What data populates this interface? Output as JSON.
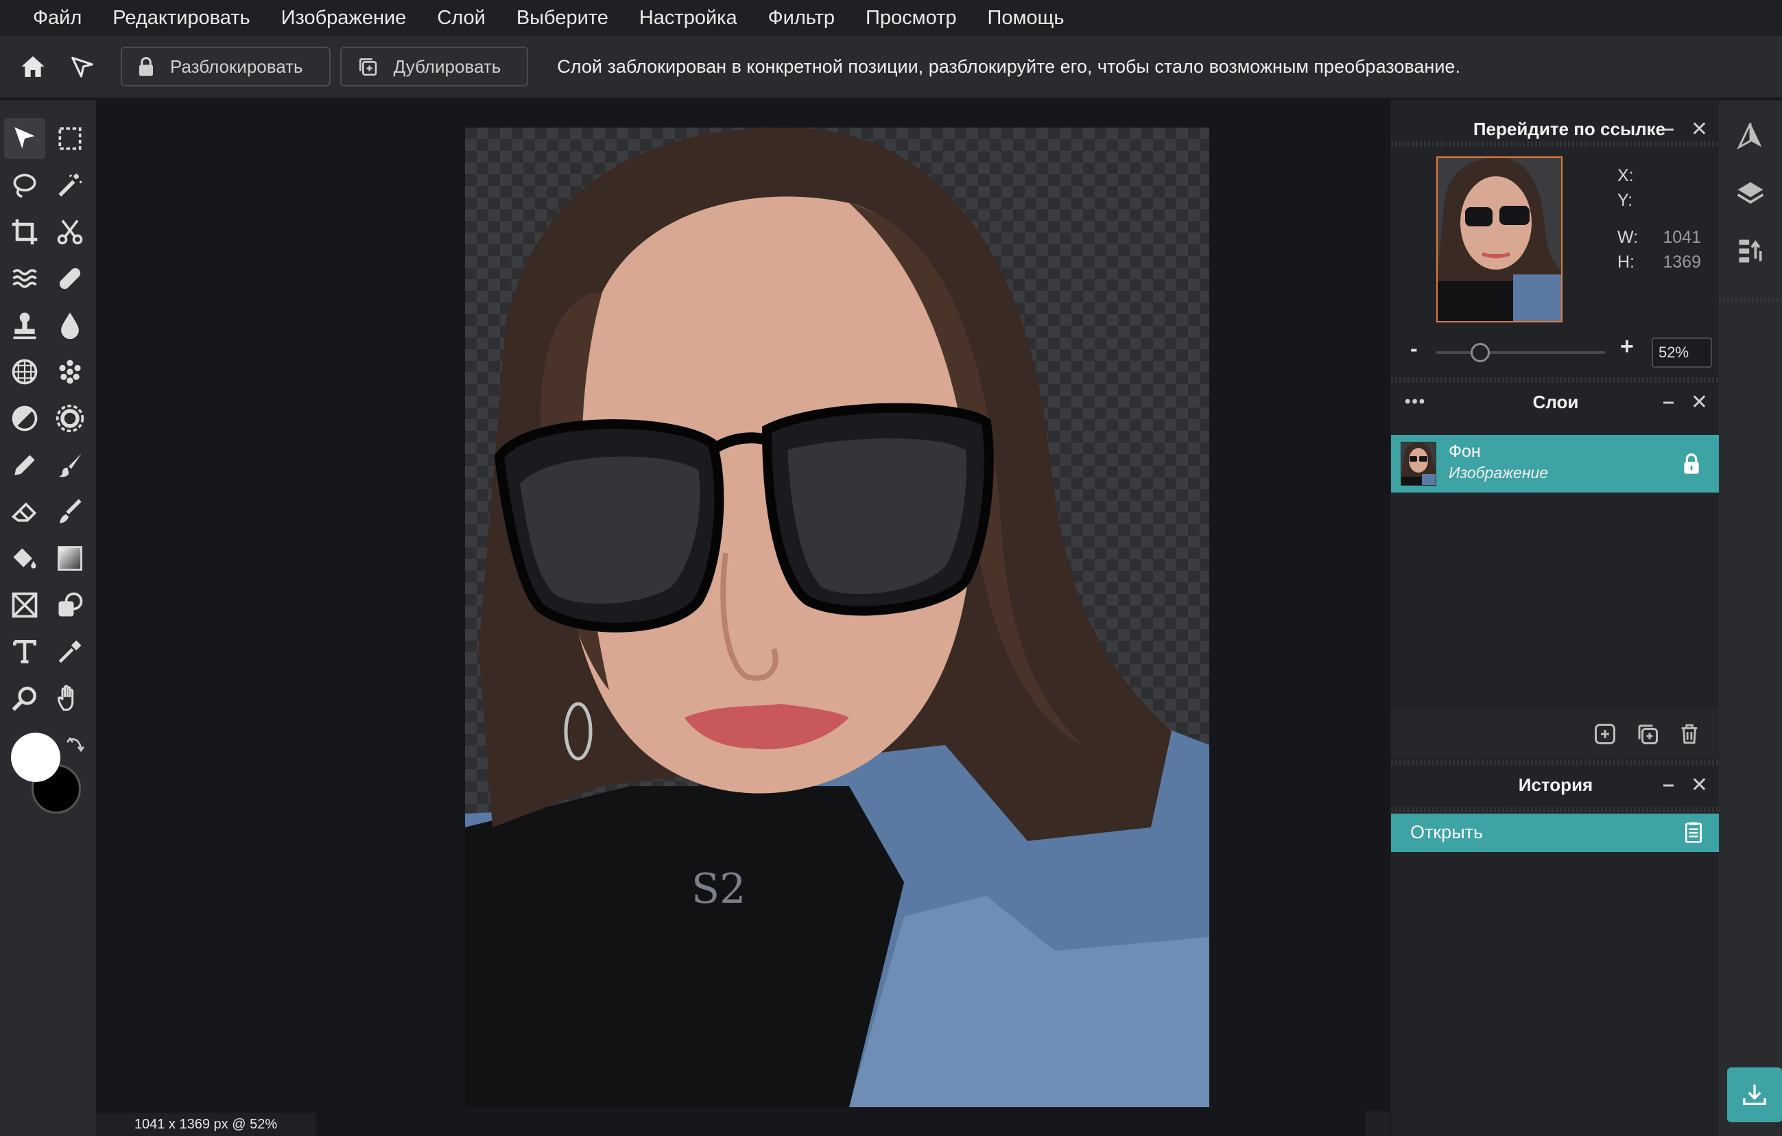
{
  "menu": [
    "Файл",
    "Редактировать",
    "Изображение",
    "Слой",
    "Выберите",
    "Настройка",
    "Фильтр",
    "Просмотр",
    "Помощь"
  ],
  "toolbar": {
    "unlock_label": "Разблокировать",
    "duplicate_label": "Дублировать",
    "message": "Слой заблокирован в конкретной позиции, разблокируйте его, чтобы стало возможным преобразование."
  },
  "navigator": {
    "title": "Перейдите по ссылке",
    "x_label": "X:",
    "y_label": "Y:",
    "w_label": "W:",
    "h_label": "H:",
    "w_value": "1041",
    "h_value": "1369",
    "zoom_minus": "-",
    "zoom_plus": "+",
    "zoom_value": "52%",
    "zoom_fraction": 0.52
  },
  "layers": {
    "title": "Слои",
    "menu": "•••",
    "items": [
      {
        "name": "Фон",
        "type": "Изображение",
        "locked": true
      }
    ]
  },
  "history": {
    "title": "История",
    "items": [
      "Открыть"
    ]
  },
  "status": "1041 x 1369 px @ 52%",
  "colors": {
    "accent": "#3ea3a4",
    "foreground_swatch": "#ffffff",
    "background_swatch": "#000000"
  }
}
